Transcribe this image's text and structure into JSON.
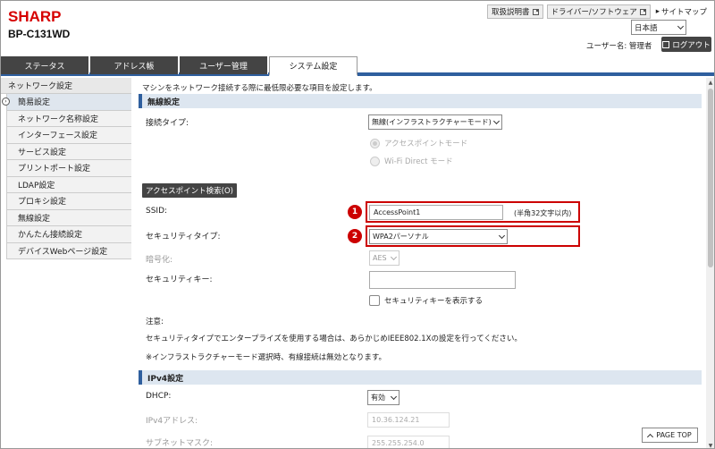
{
  "header": {
    "brand": "SHARP",
    "model": "BP-C131WD",
    "links": {
      "manual": "取扱説明書",
      "driver": "ドライバー/ソフトウェア",
      "sitemap": "サイトマップ"
    },
    "language": "日本語",
    "user_label": "ユーザー名: 管理者",
    "logout": "ログアウト"
  },
  "tabs": [
    {
      "label": "ステータス"
    },
    {
      "label": "アドレス帳"
    },
    {
      "label": "ユーザー管理"
    },
    {
      "label": "システム設定",
      "active": true
    }
  ],
  "sidebar": {
    "heading": "ネットワーク設定",
    "items": [
      {
        "label": "簡易設定",
        "active": true
      },
      {
        "label": "ネットワーク名称設定"
      },
      {
        "label": "インターフェース設定"
      },
      {
        "label": "サービス設定"
      },
      {
        "label": "プリントポート設定"
      },
      {
        "label": "LDAP設定"
      },
      {
        "label": "プロキシ設定"
      },
      {
        "label": "無線設定"
      },
      {
        "label": "かんたん接続設定"
      },
      {
        "label": "デバイスWebページ設定"
      }
    ]
  },
  "main": {
    "intro": "マシンをネットワーク接続する際に最低限必要な項目を設定します。",
    "wireless": {
      "heading": "無線設定",
      "connection_type_label": "接続タイプ:",
      "connection_type_value": "無線(インフラストラクチャーモード)",
      "radio_ap": "アクセスポイントモード",
      "radio_wifidirect": "Wi-Fi Direct モード",
      "ap_search_button": "アクセスポイント検索(O)",
      "ssid_label": "SSID:",
      "ssid_value": "AccessPoint1",
      "ssid_hint": "(半角32文字以内)",
      "security_type_label": "セキュリティタイプ:",
      "security_type_value": "WPA2パーソナル",
      "encryption_label": "暗号化:",
      "encryption_value": "AES",
      "security_key_label": "セキュリティキー:",
      "show_key_label": "セキュリティキーを表示する",
      "note_title": "注意:",
      "note_line1": "セキュリティタイプでエンタープライズを使用する場合は、あらかじめIEEE802.1Xの設定を行ってください。",
      "note_line2": "※インフラストラクチャーモード選択時、有線接続は無効となります。",
      "callout_1": "1",
      "callout_2": "2"
    },
    "ipv4": {
      "heading": "IPv4設定",
      "dhcp_label": "DHCP:",
      "dhcp_value": "有効",
      "ip_label": "IPv4アドレス:",
      "ip_value": "10.36.124.21",
      "subnet_label": "サブネットマスク:",
      "subnet_value": "255.255.254.0"
    }
  },
  "page_top": "PAGE TOP",
  "colors": {
    "brand_red": "#d60000",
    "accent_blue": "#2f5f9e",
    "callout_red": "#cc0000"
  }
}
